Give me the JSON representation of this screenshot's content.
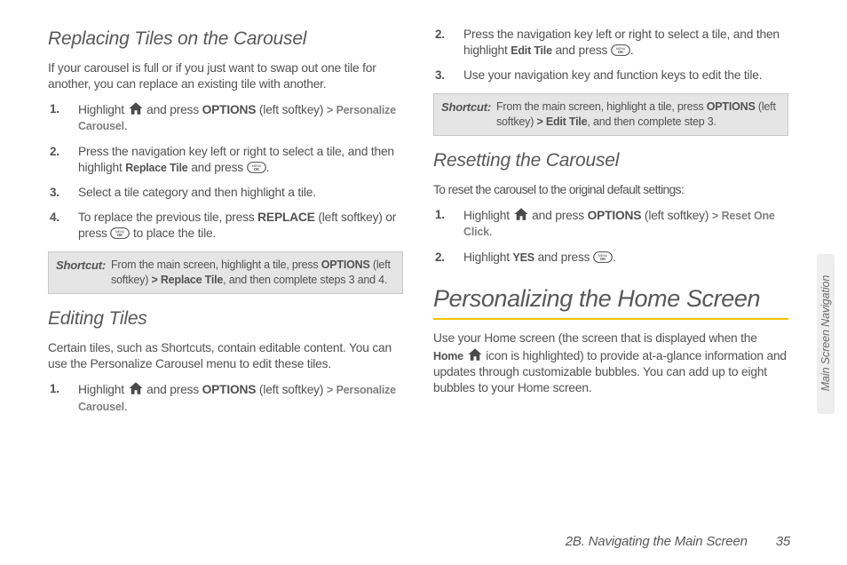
{
  "col1": {
    "h_replacing": "Replacing Tiles on the Carousel",
    "p_replacing": "If your carousel is full or if you just want to swap out one tile for another, you can replace an existing tile with another.",
    "rep_steps": {
      "s1a": "Highlight ",
      "s1b": " and press ",
      "s1_opt": "OPTIONS",
      "s1c": " (left softkey) ",
      "gt": ">",
      "s1_pc": "Personalize Carousel",
      "s1d": ".",
      "s2a": "Press the navigation key left or right to select a tile, and then highlight ",
      "s2_rt": "Replace Tile",
      "s2b": " and press ",
      "s2c": ".",
      "s3": "Select a tile category and then highlight a tile.",
      "s4a": "To replace the previous tile, press ",
      "s4_rep": "REPLACE",
      "s4b": " (left softkey) or press ",
      "s4c": " to place the tile."
    },
    "shortcut1": {
      "label": "Shortcut:",
      "t1": " From the main screen, highlight a tile, press ",
      "t_opt": "OPTIONS",
      "t2": " (left softkey) ",
      "gt": ">",
      "t_rt": "Replace Tile",
      "t3": ", and then complete steps 3 and 4."
    },
    "h_editing": "Editing Tiles",
    "p_editing": "Certain tiles, such as Shortcuts, contain editable content. You can use the Personalize Carousel menu to edit these tiles.",
    "edit_steps": {
      "s1a": "Highlight ",
      "s1b": " and press ",
      "s1_opt": "OPTIONS",
      "s1c": " (left softkey) ",
      "gt": ">",
      "s1_pc": "Personalize Carousel",
      "s1d": "."
    }
  },
  "col2": {
    "edit_cont": {
      "s2a": "Press the navigation key left or right to select a tile, and then highlight ",
      "s2_et": "Edit Tile",
      "s2b": " and press ",
      "s2c": ".",
      "s3": "Use your navigation key and function keys to edit the tile."
    },
    "shortcut2": {
      "label": "Shortcut:",
      "t1": " From the main screen, highlight a tile, press ",
      "t_opt": "OPTIONS",
      "t2": " (left softkey) ",
      "gt": ">",
      "t_et": "Edit Tile",
      "t3": ", and then complete step 3."
    },
    "h_reset": "Resetting the Carousel",
    "p_reset": "To reset the carousel to the original default settings:",
    "reset_steps": {
      "s1a": "Highlight ",
      "s1b": " and press ",
      "s1_opt": "OPTIONS",
      "s1c": " (left softkey) ",
      "gt": ">",
      "s1_roc": "Reset One Click",
      "s1d": ".",
      "s2a": "Highlight ",
      "s2_yes": "YES",
      "s2b": " and press ",
      "s2c": "."
    },
    "h_personal": "Personalizing the Home Screen",
    "p_personal_a": "Use your Home screen (the screen that is displayed when the ",
    "p_personal_home": "Home",
    "p_personal_b": " icon is highlighted) to provide at-a-glance information and updates through customizable bubbles. You can add up to eight bubbles to your Home screen."
  },
  "tab_label": "Main Screen Navigation",
  "footer_section": "2B. Navigating the Main Screen",
  "footer_page": "35",
  "nums": {
    "n1": "1.",
    "n2": "2.",
    "n3": "3.",
    "n4": "4."
  }
}
